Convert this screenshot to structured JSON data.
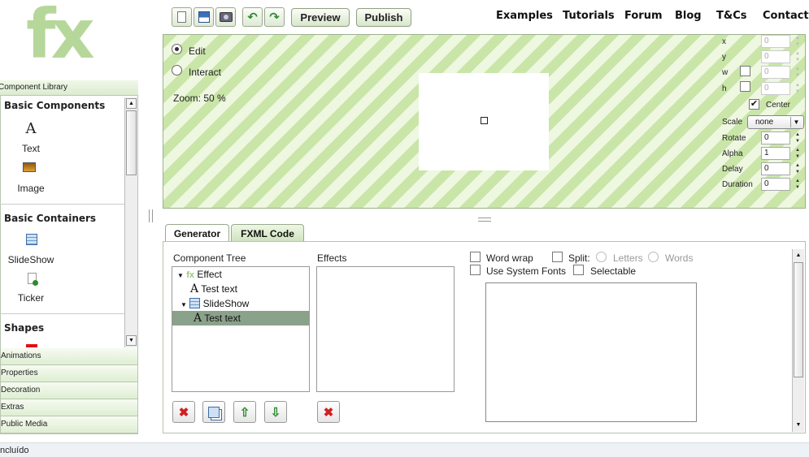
{
  "logo": {
    "text": "fx"
  },
  "toolbar": {
    "icons": [
      "new-document-icon",
      "save-icon",
      "screenshot-icon",
      "undo-icon",
      "redo-icon"
    ],
    "preview_label": "Preview",
    "publish_label": "Publish"
  },
  "nav": {
    "items": [
      "Examples",
      "Tutorials",
      "Forum",
      "Blog",
      "T&Cs",
      "Contact"
    ]
  },
  "library": {
    "header": "Component Library",
    "categories": {
      "basic_components": "Basic Components",
      "basic_containers": "Basic Containers",
      "shapes": "Shapes"
    },
    "items": {
      "text": "Text",
      "image": "Image",
      "slideshow": "SlideShow",
      "ticker": "Ticker"
    },
    "accordion": [
      "Animations",
      "Properties",
      "Decoration",
      "Extras",
      "Public Media"
    ]
  },
  "stage": {
    "mode_edit": "Edit",
    "mode_interact": "Interact",
    "selected_mode": "Edit",
    "zoom_text": "Zoom: 50 %"
  },
  "properties": {
    "x_label": "x",
    "x_value": "0",
    "y_label": "y",
    "y_value": "0",
    "w_label": "w",
    "w_value": "0",
    "h_label": "h",
    "h_value": "0",
    "center_label": "Center",
    "center_checked": true,
    "scale_label": "Scale",
    "scale_value": "none",
    "rotate_label": "Rotate",
    "rotate_value": "0",
    "alpha_label": "Alpha",
    "alpha_value": "1",
    "delay_label": "Delay",
    "delay_value": "0",
    "duration_label": "Duration",
    "duration_value": "0"
  },
  "tabs": {
    "generator": "Generator",
    "fxml": "FXML Code",
    "active": "Generator"
  },
  "generator": {
    "tree_title": "Component Tree",
    "effects_title": "Effects",
    "tree": [
      {
        "label": "Effect",
        "icon": "fx-icon"
      },
      {
        "label": "Test text",
        "icon": "text-a-icon"
      },
      {
        "label": "SlideShow",
        "icon": "slideshow-icon"
      },
      {
        "label": "Test text",
        "icon": "text-a-icon",
        "selected": true
      }
    ],
    "options": {
      "word_wrap": "Word wrap",
      "split": "Split:",
      "letters": "Letters",
      "words": "Words",
      "system_fonts": "Use System Fonts",
      "selectable": "Selectable"
    }
  },
  "colors": {
    "accent_green": "#b6d79a",
    "stripe_dark": "#c9e5a8",
    "stripe_light": "#eef7e0",
    "delete_red": "#d02020",
    "arrow_green": "#2e8b2e",
    "selected_row": "#8aa18a"
  },
  "status": {
    "text": "ncluído"
  }
}
